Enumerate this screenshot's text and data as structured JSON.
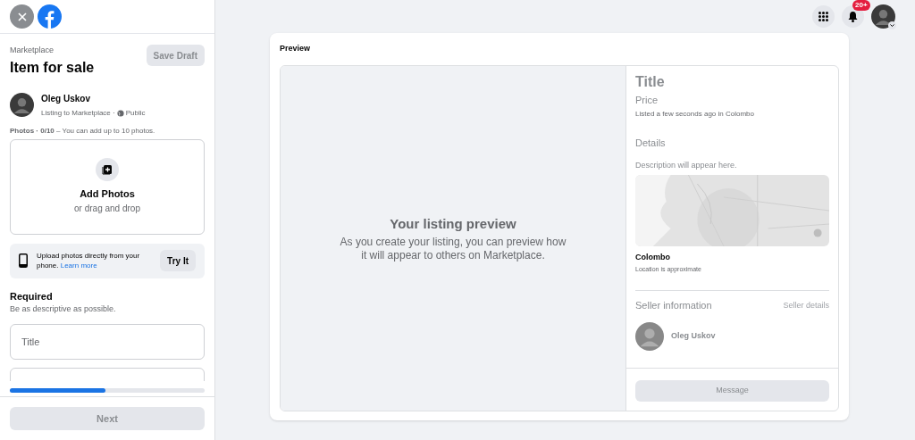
{
  "sidebar": {
    "breadcrumb": "Marketplace",
    "title": "Item for sale",
    "save_button": {
      "label": "Save Draft",
      "disabled": true
    },
    "user": {
      "name": "Oleg Uskov",
      "subtitle": "Listing to Marketplace ·",
      "audience": "Public"
    },
    "photos_hint": "**Photos · 0/10** – You can add up to 10 photos.",
    "add_photos": {
      "title": "Add Photos",
      "subtitle": "or drag and drop"
    },
    "phone_upload": {
      "text": "Upload photos directly from your phone.",
      "link": "Learn more",
      "button": "Try It"
    },
    "required": {
      "heading": "Required",
      "hint": "Be as descriptive as possible."
    },
    "fields": [
      {
        "kind": "text",
        "placeholder": "Title"
      },
      {
        "kind": "text"
      }
    ],
    "progress": {
      "level": 0.49
    },
    "next_button": {
      "label": "Next",
      "disabled": true
    }
  },
  "topbar": {
    "notification_badge": "20+"
  },
  "preview": {
    "heading": "Preview",
    "placeholder_title": "Your listing preview",
    "placeholder_text": "As you create your listing, you can preview how it will appear to others on Marketplace.",
    "title": "Title",
    "price": "Price",
    "listed": "Listed a few seconds ago in Colombo",
    "details_heading": "Details",
    "description_note": "Description will appear here.",
    "location": "Colombo",
    "location_note": "Location is approximate",
    "seller_heading": "Seller information",
    "seller_link": "Seller details",
    "seller_name": "Oleg Uskov",
    "message_button": {
      "label": "Message",
      "disabled": true
    }
  }
}
